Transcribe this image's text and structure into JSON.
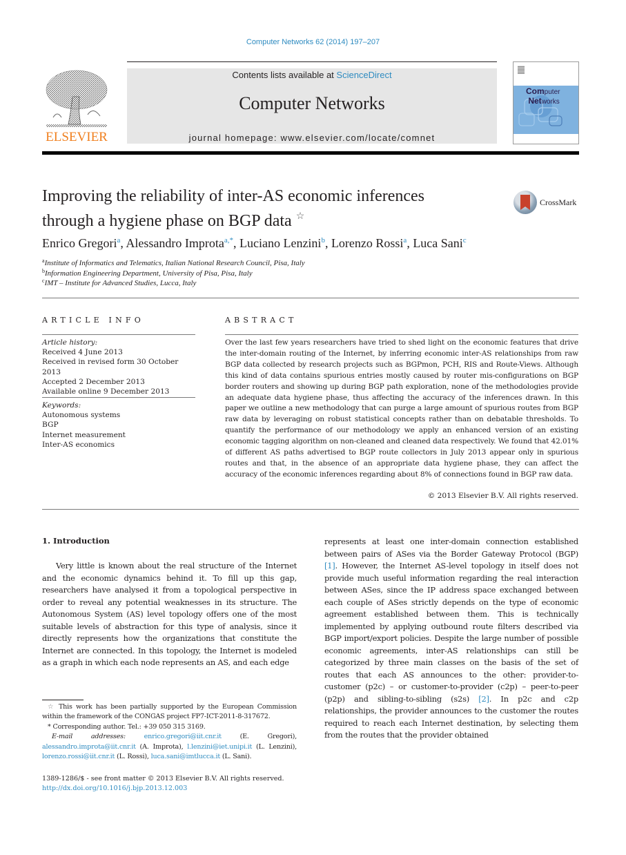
{
  "journal_citation": "Computer Networks 62 (2014) 197–207",
  "masthead": {
    "publisher_logo_text": "ELSEVIER",
    "contents_prefix": "Contents lists available at ",
    "contents_link": "ScienceDirect",
    "journal_title": "Computer Networks",
    "homepage": "journal homepage: www.elsevier.com/locate/comnet",
    "cover_title_line1_big": "Com",
    "cover_title_line1_small": "puter",
    "cover_title_line2_big": "Net",
    "cover_title_line2_small": "works"
  },
  "article": {
    "title_line1": "Improving the reliability of inter-AS economic inferences",
    "title_line2": "through a hygiene phase on BGP data",
    "title_note_mark": "☆",
    "crossmark_label": "CrossMark",
    "authors": [
      {
        "name": "Enrico Gregori",
        "sup": "a"
      },
      {
        "name": "Alessandro Improta",
        "sup": "a,*"
      },
      {
        "name": "Luciano Lenzini",
        "sup": "b"
      },
      {
        "name": "Lorenzo Rossi",
        "sup": "a"
      },
      {
        "name": "Luca Sani",
        "sup": "c"
      }
    ],
    "affiliations": [
      {
        "mark": "a",
        "text": "Institute of Informatics and Telematics, Italian National Research Council, Pisa, Italy"
      },
      {
        "mark": "b",
        "text": "Information Engineering Department, University of Pisa, Pisa, Italy"
      },
      {
        "mark": "c",
        "text": "IMT – Institute for Advanced Studies, Lucca, Italy"
      }
    ]
  },
  "article_info": {
    "heading": "ARTICLE INFO",
    "history_label": "Article history:",
    "history": [
      "Received 4 June 2013",
      "Received in revised form 30 October 2013",
      "Accepted 2 December 2013",
      "Available online 9 December 2013"
    ],
    "keywords_label": "Keywords:",
    "keywords": [
      "Autonomous systems",
      "BGP",
      "Internet measurement",
      "Inter-AS economics"
    ]
  },
  "abstract": {
    "heading": "ABSTRACT",
    "text": "Over the last few years researchers have tried to shed light on the economic features that drive the inter-domain routing of the Internet, by inferring economic inter-AS relationships from raw BGP data collected by research projects such as BGPmon, PCH, RIS and Route-Views. Although this kind of data contains spurious entries mostly caused by router mis-configurations on BGP border routers and showing up during BGP path exploration, none of the methodologies provide an adequate data hygiene phase, thus affecting the accuracy of the inferences drawn. In this paper we outline a new methodology that can purge a large amount of spurious routes from BGP raw data by leveraging on robust statistical concepts rather than on debatable thresholds. To quantify the performance of our methodology we apply an enhanced version of an existing economic tagging algorithm on non-cleaned and cleaned data respectively. We found that 42.01% of different AS paths advertised to BGP route collectors in July 2013 appear only in spurious routes and that, in the absence of an appropriate data hygiene phase, they can affect the accuracy of the economic inferences regarding about 8% of connections found in BGP raw data.",
    "copyright": "© 2013 Elsevier B.V. All rights reserved."
  },
  "introduction": {
    "heading": "1. Introduction",
    "left_column": "Very little is known about the real structure of the Internet and the economic dynamics behind it. To fill up this gap, researchers have analysed it from a topological perspective in order to reveal any potential weaknesses in its structure. The Autonomous System (AS) level topology offers one of the most suitable levels of abstraction for this type of analysis, since it directly represents how the organizations that constitute the Internet are connected. In this topology, the Internet is modeled as a graph in which each node represents an AS, and each edge",
    "right_part1": "represents at least one inter-domain connection established between pairs of ASes via the Border Gateway Protocol (BGP) ",
    "ref1": "[1]",
    "right_part2": ". However, the Internet AS-level topology in itself does not provide much useful information regarding the real interaction between ASes, since the IP address space exchanged between each couple of ASes strictly depends on the type of economic agreement established between them. This is technically implemented by applying outbound route filters described via BGP import/export policies. Despite the large number of possible economic agreements, inter-AS relationships can still be categorized by three main classes on the basis of the set of routes that each AS announces to the other: provider-to-customer (p2c) – or customer-to-provider (c2p) – peer-to-peer (p2p) and sibling-to-sibling (s2s) ",
    "ref2": "[2]",
    "right_part3": ". In p2c and c2p relationships, the provider announces to the customer the routes required to reach each Internet destination, by selecting them from the routes that the provider obtained"
  },
  "footnotes": {
    "funding_mark": "☆",
    "funding": " This work has been partially supported by the European Commission within the framework of the CONGAS project FP7-ICT-2011-8-317672.",
    "corresponding_mark": "*",
    "corresponding": " Corresponding author. Tel.: +39 050 315 3169.",
    "email_label": "E-mail addresses: ",
    "emails": [
      {
        "address": "enrico.gregori@iit.cnr.it",
        "who": " (E. Gregori), "
      },
      {
        "address": "alessandro.improta@iit.cnr.it",
        "who": " (A. Improta), "
      },
      {
        "address": "l.lenzini@iet.unipi.it",
        "who": " (L. Lenzini), "
      },
      {
        "address": "lorenzo.rossi@iit.cnr.it",
        "who": " (L. Rossi), "
      },
      {
        "address": "luca.sani@imtlucca.it",
        "who": " (L. Sani)."
      }
    ],
    "front_matter": "1389-1286/$ - see front matter © 2013 Elsevier B.V. All rights reserved.",
    "doi": "http://dx.doi.org/10.1016/j.bjp.2013.12.003"
  },
  "colors": {
    "link": "#2e8bc0",
    "elsevier_orange": "#f07f1e",
    "masthead_band": "#e6e6e6",
    "cover_blue": "#7fb2df"
  }
}
